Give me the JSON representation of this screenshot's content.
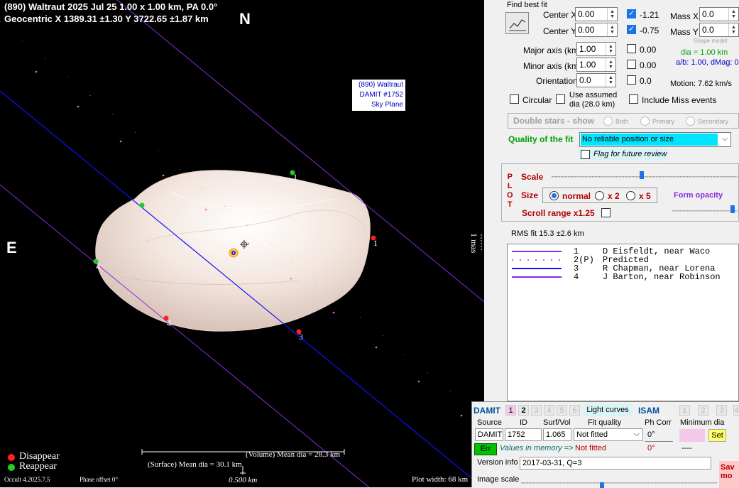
{
  "plot": {
    "title_line1": "(890) Waltraut  2025 Jul 25   1.00 x 1.00 km, PA 0.0°",
    "title_line2": "Geocentric  X  1389.31 ±1.30  Y 3722.65 ±1.87 km",
    "north": "N",
    "east": "E",
    "label_box": [
      "(890) Waltraut",
      "DAMIT #1752",
      "Sky Plane"
    ],
    "chord_labels": [
      "1",
      "1",
      "4",
      "4",
      "3"
    ],
    "scale_vertical": "1 mas",
    "legend_disappear": "Disappear",
    "legend_reappear": "Reappear",
    "volume_mean": "(Volume) Mean dia = 28.3 km",
    "surface_mean": "(Surface) Mean dia = 30.1 km",
    "version": "Occult 4.2025.7.5",
    "phase_offset": "Phase offset 0°",
    "scale_km": "0.500 km",
    "plot_width": "Plot width: 68 km",
    "colors": {
      "disappear": "#ff2020",
      "reappear": "#22cc22",
      "chord_purple": "#8a2be2",
      "chord_blue": "#1010ff"
    }
  },
  "panel": {
    "find_best_fit": "Find best fit",
    "center_x_label": "Center X",
    "center_x": "0.00",
    "center_x_result": "-1.21",
    "center_y_label": "Center Y",
    "center_y": "0.00",
    "center_y_result": "-0.75",
    "mass_x_label": "Mass X",
    "mass_x": "0.0",
    "mass_y_label": "Mass Y",
    "mass_y": "0.0",
    "shape_model": "Shape model",
    "major_axis_label": "Major axis (km)",
    "major_axis": "1.00",
    "major_axis_result": "0.00",
    "minor_axis_label": "Minor axis (km)",
    "minor_axis": "1.00",
    "minor_axis_result": "0.00",
    "orientation_label": "Orientation",
    "orientation": "0.0",
    "orientation_result": "0.0",
    "dia": "dia = 1.00 km",
    "ab_dmag": "a/b: 1.00, dMag: 0.00",
    "motion": "Motion: 7.62 km/s",
    "circular": "Circular",
    "use_assumed": "Use assumed",
    "use_assumed_dia": "dia (28.0 km)",
    "include_miss": "Include Miss events",
    "double_stars": "Double stars - show",
    "both": "Both",
    "primary": "Primary",
    "secondary": "Secondary",
    "quality_label": "Quality of the fit",
    "quality_value": "No reliable position or size",
    "flag_review": "Flag for future review",
    "plot_vertical": [
      "P",
      "L",
      "O",
      "T"
    ],
    "scale_label": "Scale",
    "size_label": "Size",
    "size_normal": "normal",
    "size_x2": "x 2",
    "size_x5": "x 5",
    "form_opacity": "Form opacity",
    "scroll_range": "Scroll range x1.25",
    "rms_fit": "RMS fit 15.3 ±2.6 km"
  },
  "observers": [
    {
      "num": "1",
      "text": "D Eisfeldt, near Waco",
      "style": "solid",
      "color": "#8a2be2"
    },
    {
      "num": "2(P)",
      "text": "Predicted",
      "style": "dotted",
      "color": "#d060d0"
    },
    {
      "num": "3",
      "text": "R Chapman, near Lorena",
      "style": "solid",
      "color": "#1010ff"
    },
    {
      "num": "4",
      "text": "J Barton, near Robinson",
      "style": "solid",
      "color": "#8a2be2"
    }
  ],
  "damit": {
    "damit_label": "DAMIT",
    "tabs": [
      "1",
      "2",
      "3",
      "4",
      "5",
      "6"
    ],
    "light_curves": "Light curves",
    "isam_label": "ISAM",
    "isam_tabs": [
      "1",
      "2",
      "3",
      "4"
    ],
    "source_hdr": "Source",
    "id_hdr": "ID",
    "surfvol_hdr": "Surf/Vol",
    "fit_quality_hdr": "Fit quality",
    "ph_corr_hdr": "Ph Corr",
    "min_dia_hdr": "Minimum dia",
    "source": "DAMIT",
    "id": "1752",
    "surfvol": "1.065",
    "fit_quality": "Not fitted",
    "ph_corr": "0°",
    "set": "Set",
    "err": "Err",
    "values_memory": "Values in memory =>",
    "fit_quality2": "Not fitted",
    "ph_corr2": "0°",
    "min_dia2": "----",
    "version_info_label": "Version info",
    "version_info": "2017-03-31, Q=3",
    "image_scale_label": "Image scale",
    "save_label": "Sav mo"
  }
}
